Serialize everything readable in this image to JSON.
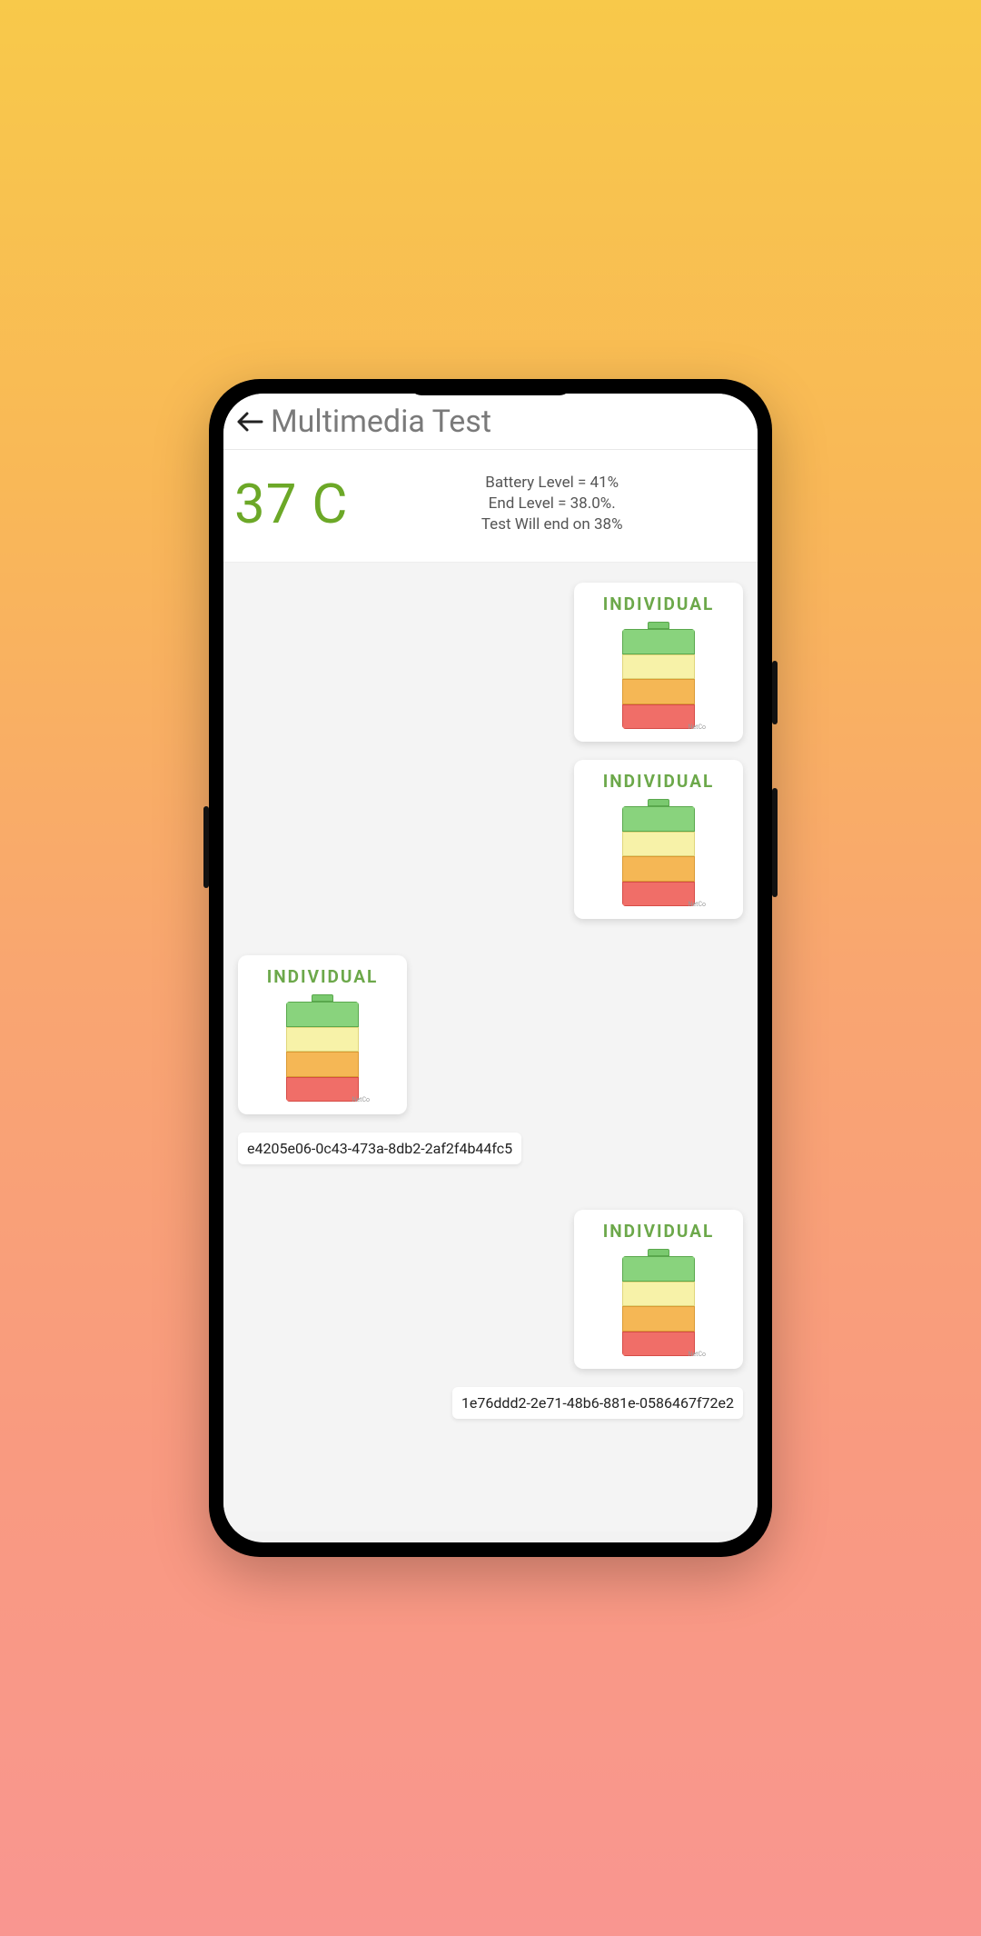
{
  "header": {
    "title": "Multimedia Test"
  },
  "stats": {
    "temperature": "37 C",
    "battery_level_line": "Battery Level = 41%",
    "end_level_line": "End Level = 38.0%.",
    "will_end_line": "Test Will end on 38%"
  },
  "cards": {
    "label": "INDIVIDUAL"
  },
  "messages": {
    "left_id": "e4205e06-0c43-473a-8db2-2af2f4b44fc5",
    "right_id": "1e76ddd2-2e71-48b6-881e-0586467f72e2"
  }
}
